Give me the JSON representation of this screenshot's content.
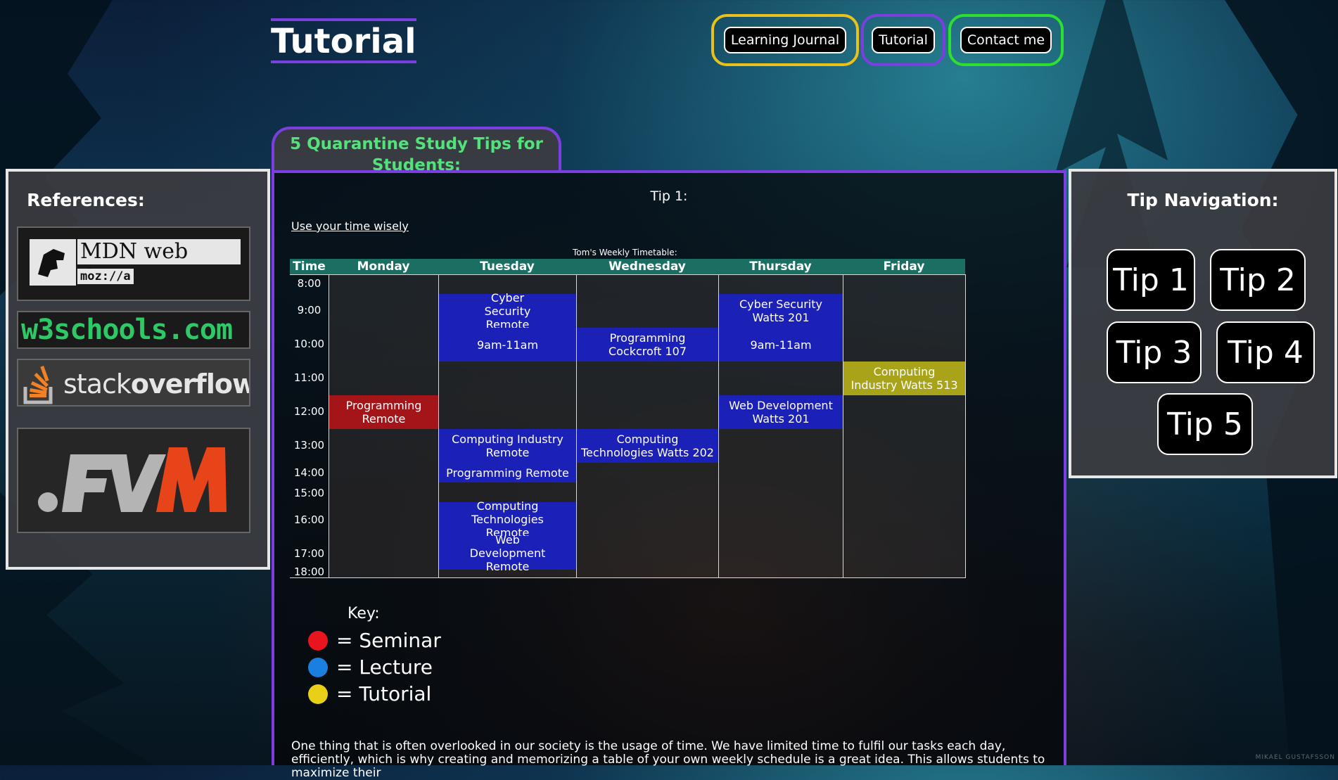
{
  "page": {
    "title": "Tutorial",
    "credit": "MIKAEL GUSTAFSSON"
  },
  "nav": {
    "items": [
      {
        "label": "Learning Journal",
        "accent": "#e8c21a"
      },
      {
        "label": "Tutorial",
        "accent": "#7b3fe0"
      },
      {
        "label": "Contact me",
        "accent": "#2ee02e"
      }
    ]
  },
  "references": {
    "heading": "References:",
    "logos": [
      {
        "name": "MDN web docs",
        "sub": "moz://a"
      },
      {
        "name": "w3schools.com"
      },
      {
        "name": "stackoverflow",
        "prefix": "stack",
        "suffix": "overflow"
      },
      {
        "name": "FVM"
      }
    ]
  },
  "tip_navigation": {
    "heading": "Tip Navigation:",
    "tips": [
      "Tip 1",
      "Tip 2",
      "Tip 3",
      "Tip 4",
      "Tip 5"
    ]
  },
  "section": {
    "tab_label": "5 Quarantine Study Tips for Students:",
    "tip_title": "Tip 1:",
    "tip_link": "Use your time wisely",
    "timetable_caption": "Tom's Weekly Timetable:",
    "intro_text": "One thing that is often overlooked in our society is the usage of time. We have limited time to fulfil our tasks each day, efficiently, which is why creating and memorizing a table of your own weekly schedule is a great idea. This allows students to maximize their"
  },
  "timetable": {
    "headers": [
      "Time",
      "Monday",
      "Tuesday",
      "Wednesday",
      "Thursday",
      "Friday"
    ],
    "times": [
      "8:00",
      "9:00",
      "10:00",
      "11:00",
      "12:00",
      "13:00",
      "14:00",
      "15:00",
      "16:00",
      "17:00",
      "18:00"
    ],
    "events": [
      {
        "day": "Monday",
        "label": "Programming Remote",
        "type": "seminar"
      },
      {
        "day": "Tuesday",
        "label": "Cyber Security Remote",
        "type": "lecture"
      },
      {
        "day": "Tuesday",
        "label": "9am-11am",
        "type": "lecture"
      },
      {
        "day": "Tuesday",
        "label": "Computing Industry Remote",
        "type": "lecture"
      },
      {
        "day": "Tuesday",
        "label": "Programming Remote",
        "type": "lecture"
      },
      {
        "day": "Tuesday",
        "label": "Computing Technologies Remote",
        "type": "lecture"
      },
      {
        "day": "Tuesday",
        "label": "Web Development Remote",
        "type": "lecture"
      },
      {
        "day": "Wednesday",
        "label": "Programming Cockcroft 107",
        "type": "lecture"
      },
      {
        "day": "Wednesday",
        "label": "Computing Technologies Watts 202",
        "type": "lecture"
      },
      {
        "day": "Thursday",
        "label": "Cyber Security Watts 201",
        "type": "lecture"
      },
      {
        "day": "Thursday",
        "label": "9am-11am",
        "type": "lecture"
      },
      {
        "day": "Thursday",
        "label": "Web Development Watts 201",
        "type": "lecture"
      },
      {
        "day": "Friday",
        "label": "Computing Industry Watts 513",
        "type": "tutorial"
      }
    ]
  },
  "key": {
    "title": "Key:",
    "items": [
      {
        "label": "= Seminar",
        "color": "#e8141e"
      },
      {
        "label": "= Lecture",
        "color": "#1b7fe0"
      },
      {
        "label": "= Tutorial",
        "color": "#e8d018"
      }
    ]
  }
}
